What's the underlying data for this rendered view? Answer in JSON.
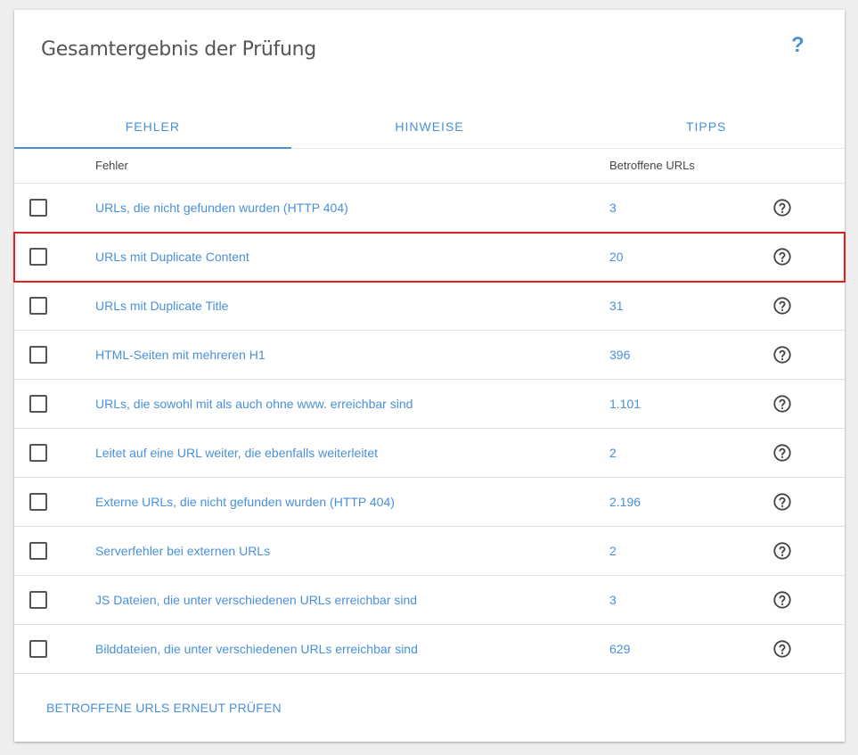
{
  "card": {
    "title": "Gesamtergebnis der Prüfung",
    "help_glyph": "?"
  },
  "tabs": [
    {
      "label": "FEHLER",
      "active": true
    },
    {
      "label": "HINWEISE",
      "active": false
    },
    {
      "label": "TIPPS",
      "active": false
    }
  ],
  "table": {
    "headers": {
      "error": "Fehler",
      "urls": "Betroffene URLs"
    },
    "rows": [
      {
        "label": "URLs, die nicht gefunden wurden (HTTP 404)",
        "count": "3",
        "highlighted": false
      },
      {
        "label": "URLs mit Duplicate Content",
        "count": "20",
        "highlighted": true
      },
      {
        "label": "URLs mit Duplicate Title",
        "count": "31",
        "highlighted": false
      },
      {
        "label": "HTML-Seiten mit mehreren H1",
        "count": "396",
        "highlighted": false
      },
      {
        "label": "URLs, die sowohl mit als auch ohne www. erreichbar sind",
        "count": "1.101",
        "highlighted": false
      },
      {
        "label": "Leitet auf eine URL weiter, die ebenfalls weiterleitet",
        "count": "2",
        "highlighted": false
      },
      {
        "label": "Externe URLs, die nicht gefunden wurden (HTTP 404)",
        "count": "2.196",
        "highlighted": false
      },
      {
        "label": "Serverfehler bei externen URLs",
        "count": "2",
        "highlighted": false
      },
      {
        "label": "JS Dateien, die unter verschiedenen URLs erreichbar sind",
        "count": "3",
        "highlighted": false
      },
      {
        "label": "Bilddateien, die unter verschiedenen URLs erreichbar sind",
        "count": "629",
        "highlighted": false
      }
    ]
  },
  "footer": {
    "recheck_label": "BETROFFENE URLS ERNEUT PRÜFEN"
  },
  "colors": {
    "accent": "#4a90d9",
    "highlight": "#e02020",
    "background": "#eeeeee"
  }
}
